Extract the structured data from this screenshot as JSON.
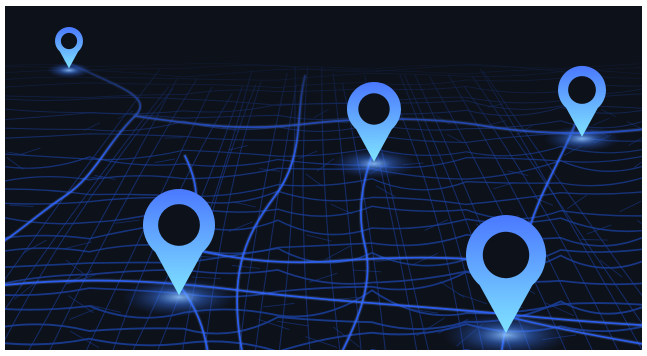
{
  "map": {
    "theme": "dark-navigation",
    "colors": {
      "background": "#0d1119",
      "road_major": "#2f63ff",
      "road_minor": "#1a3e99",
      "road_glow": "#6fa6ff",
      "pin_top": "#4a78ff",
      "pin_bottom": "#7fe3ff",
      "pin_hole": "#0d1119"
    },
    "pins": [
      {
        "icon": "location-pin-icon",
        "id": "pin-far-left"
      },
      {
        "icon": "location-pin-icon",
        "id": "pin-center"
      },
      {
        "icon": "location-pin-icon",
        "id": "pin-far-right"
      },
      {
        "icon": "location-pin-icon",
        "id": "pin-front-left"
      },
      {
        "icon": "location-pin-icon",
        "id": "pin-front-right"
      }
    ]
  }
}
